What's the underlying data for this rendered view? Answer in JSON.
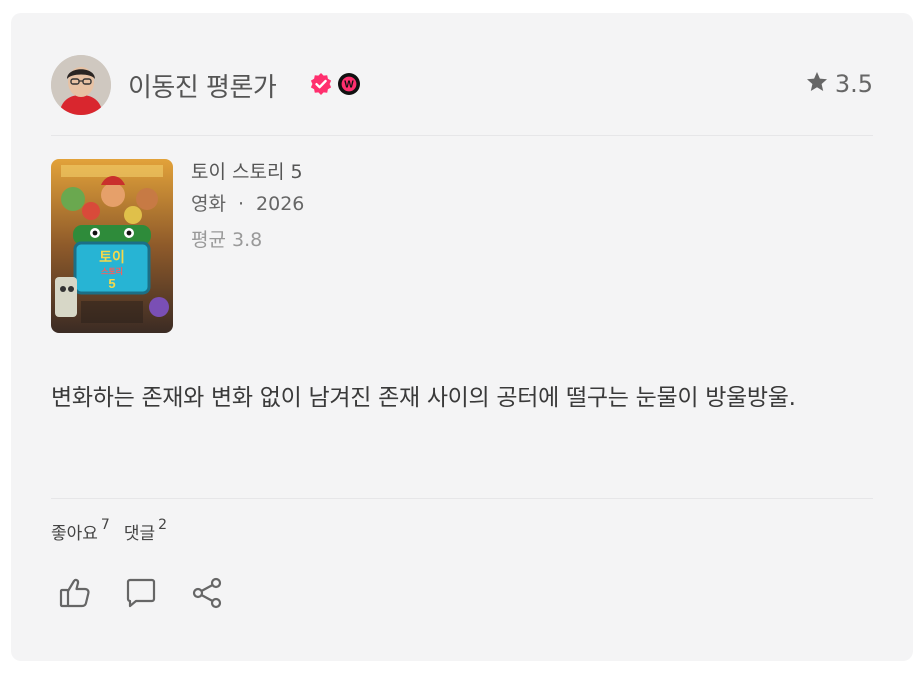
{
  "reviewer": {
    "name": "이동진 평론가",
    "verified_badge_color": "#ff2f6e",
    "watcha_badge_letter": "W",
    "rating": "3.5"
  },
  "movie": {
    "title": "토이 스토리 5",
    "type": "영화",
    "separator": "·",
    "year": "2026",
    "average": "평균 3.8",
    "poster_title_line1": "토이",
    "poster_title_line2": "스토리",
    "poster_title_line3": "5"
  },
  "review": {
    "text": "변화하는 존재와 변화 없이 남겨진 존재 사이의 공터에 떨구는 눈물이 방울방울."
  },
  "stats": {
    "likes_label": "좋아요",
    "likes_count": "7",
    "comments_label": "댓글",
    "comments_count": "2"
  },
  "icons": {
    "rating": "star-icon",
    "like": "thumbs-up-icon",
    "comment": "speech-bubble-icon",
    "share": "share-icon"
  },
  "colors": {
    "card_background": "#f4f4f5",
    "accent_pink": "#ff2f6e"
  }
}
